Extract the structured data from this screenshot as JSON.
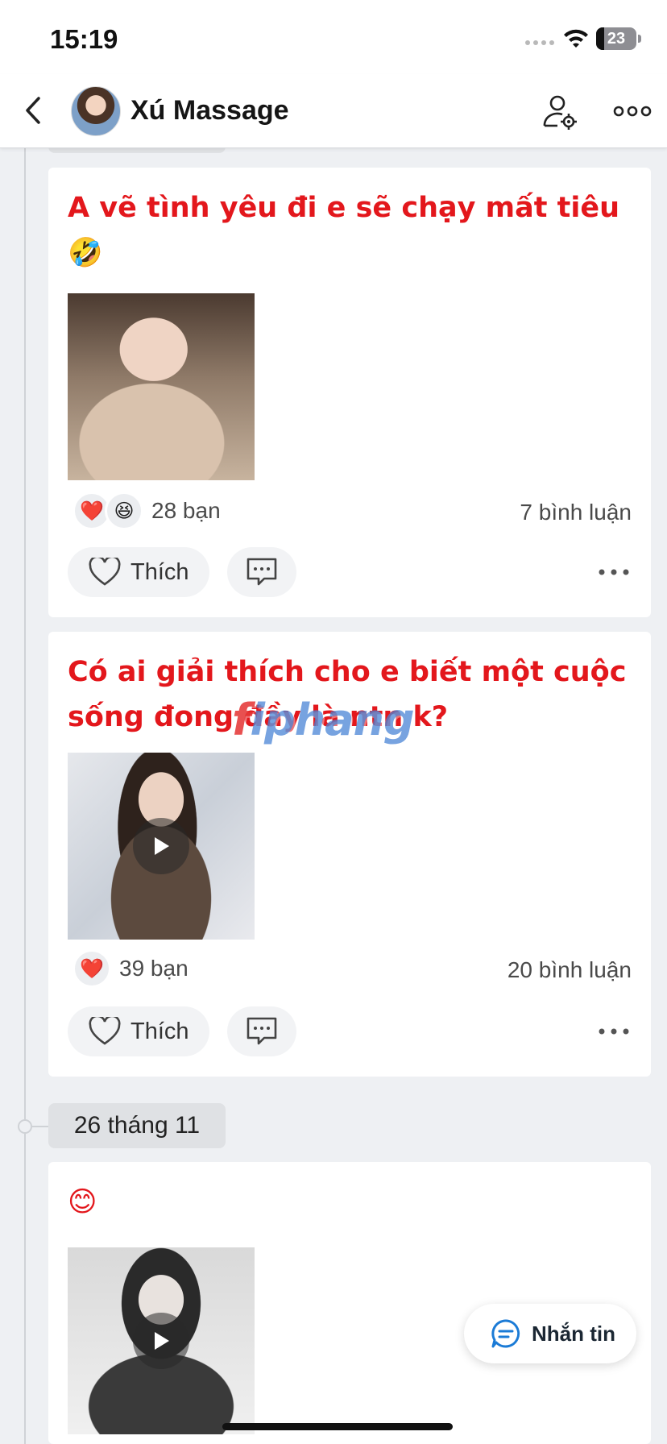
{
  "status_bar": {
    "time": "15:19",
    "battery": "23"
  },
  "header": {
    "profile_name": "Xú Massage"
  },
  "watermark": {
    "first_letter": "f",
    "rest": "iphang"
  },
  "posts": [
    {
      "text": "A vẽ tình yêu đi e sẽ chạy mất tiêu 🤣",
      "reaction_emojis": [
        "❤️",
        "😆"
      ],
      "reaction_count": "28 bạn",
      "comment_count": "7 bình luận",
      "like_label": "Thích",
      "has_video": false
    },
    {
      "text": "Có ai giải thích cho e biết một cuộc sống đong đầy là ntn k?",
      "reaction_emojis": [
        "❤️"
      ],
      "reaction_count": "39 bạn",
      "comment_count": "20 bình luận",
      "like_label": "Thích",
      "has_video": true
    },
    {
      "text": "😊",
      "has_video": true
    }
  ],
  "date_separator": "26 tháng 11",
  "message_button": {
    "label": "Nhắn tin"
  },
  "colors": {
    "post_text": "#e3171c",
    "accent_blue": "#1b7bd6",
    "background": "#eef0f3"
  }
}
